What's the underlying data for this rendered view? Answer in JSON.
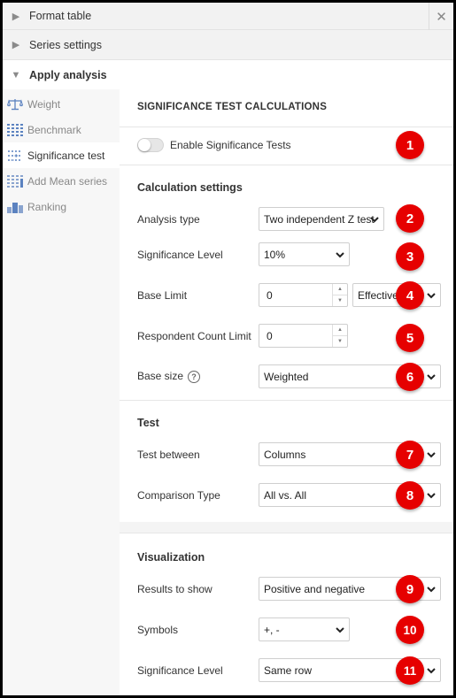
{
  "accordion": {
    "format_table": "Format table",
    "series_settings": "Series settings",
    "apply_analysis": "Apply analysis",
    "close_glyph": "✕"
  },
  "sidebar": {
    "items": [
      {
        "label": "Weight",
        "icon": "scale-icon"
      },
      {
        "label": "Benchmark",
        "icon": "benchmark-icon"
      },
      {
        "label": "Significance test",
        "icon": "significance-icon",
        "active": true
      },
      {
        "label": "Add Mean series",
        "icon": "mean-series-icon"
      },
      {
        "label": "Ranking",
        "icon": "ranking-icon"
      }
    ]
  },
  "main": {
    "section_title": "SIGNIFICANCE TEST CALCULATIONS",
    "enable_toggle": {
      "label": "Enable Significance Tests",
      "on": false
    },
    "calc": {
      "heading": "Calculation settings",
      "analysis_type": {
        "label": "Analysis type",
        "value": "Two independent Z test"
      },
      "significance_level": {
        "label": "Significance Level",
        "value": "10%"
      },
      "base_limit": {
        "label": "Base Limit",
        "value": "0",
        "mode": "Effective"
      },
      "respondent_limit": {
        "label": "Respondent Count Limit",
        "value": "0"
      },
      "base_size": {
        "label": "Base size",
        "help": "?",
        "value": "Weighted"
      }
    },
    "test": {
      "heading": "Test",
      "test_between": {
        "label": "Test between",
        "value": "Columns"
      },
      "comparison_type": {
        "label": "Comparison Type",
        "value": "All vs. All"
      }
    },
    "viz": {
      "heading": "Visualization",
      "results_to_show": {
        "label": "Results to show",
        "value": "Positive and negative"
      },
      "symbols": {
        "label": "Symbols",
        "value": "+, -"
      },
      "significance_level": {
        "label": "Significance Level",
        "value": "Same row"
      }
    }
  },
  "badges": [
    "1",
    "2",
    "3",
    "4",
    "5",
    "6",
    "7",
    "8",
    "9",
    "10",
    "11"
  ],
  "colors": {
    "badge": "#e60000",
    "sidebar_bg": "#f7f7f7",
    "icon_blue": "#5b82c0"
  }
}
